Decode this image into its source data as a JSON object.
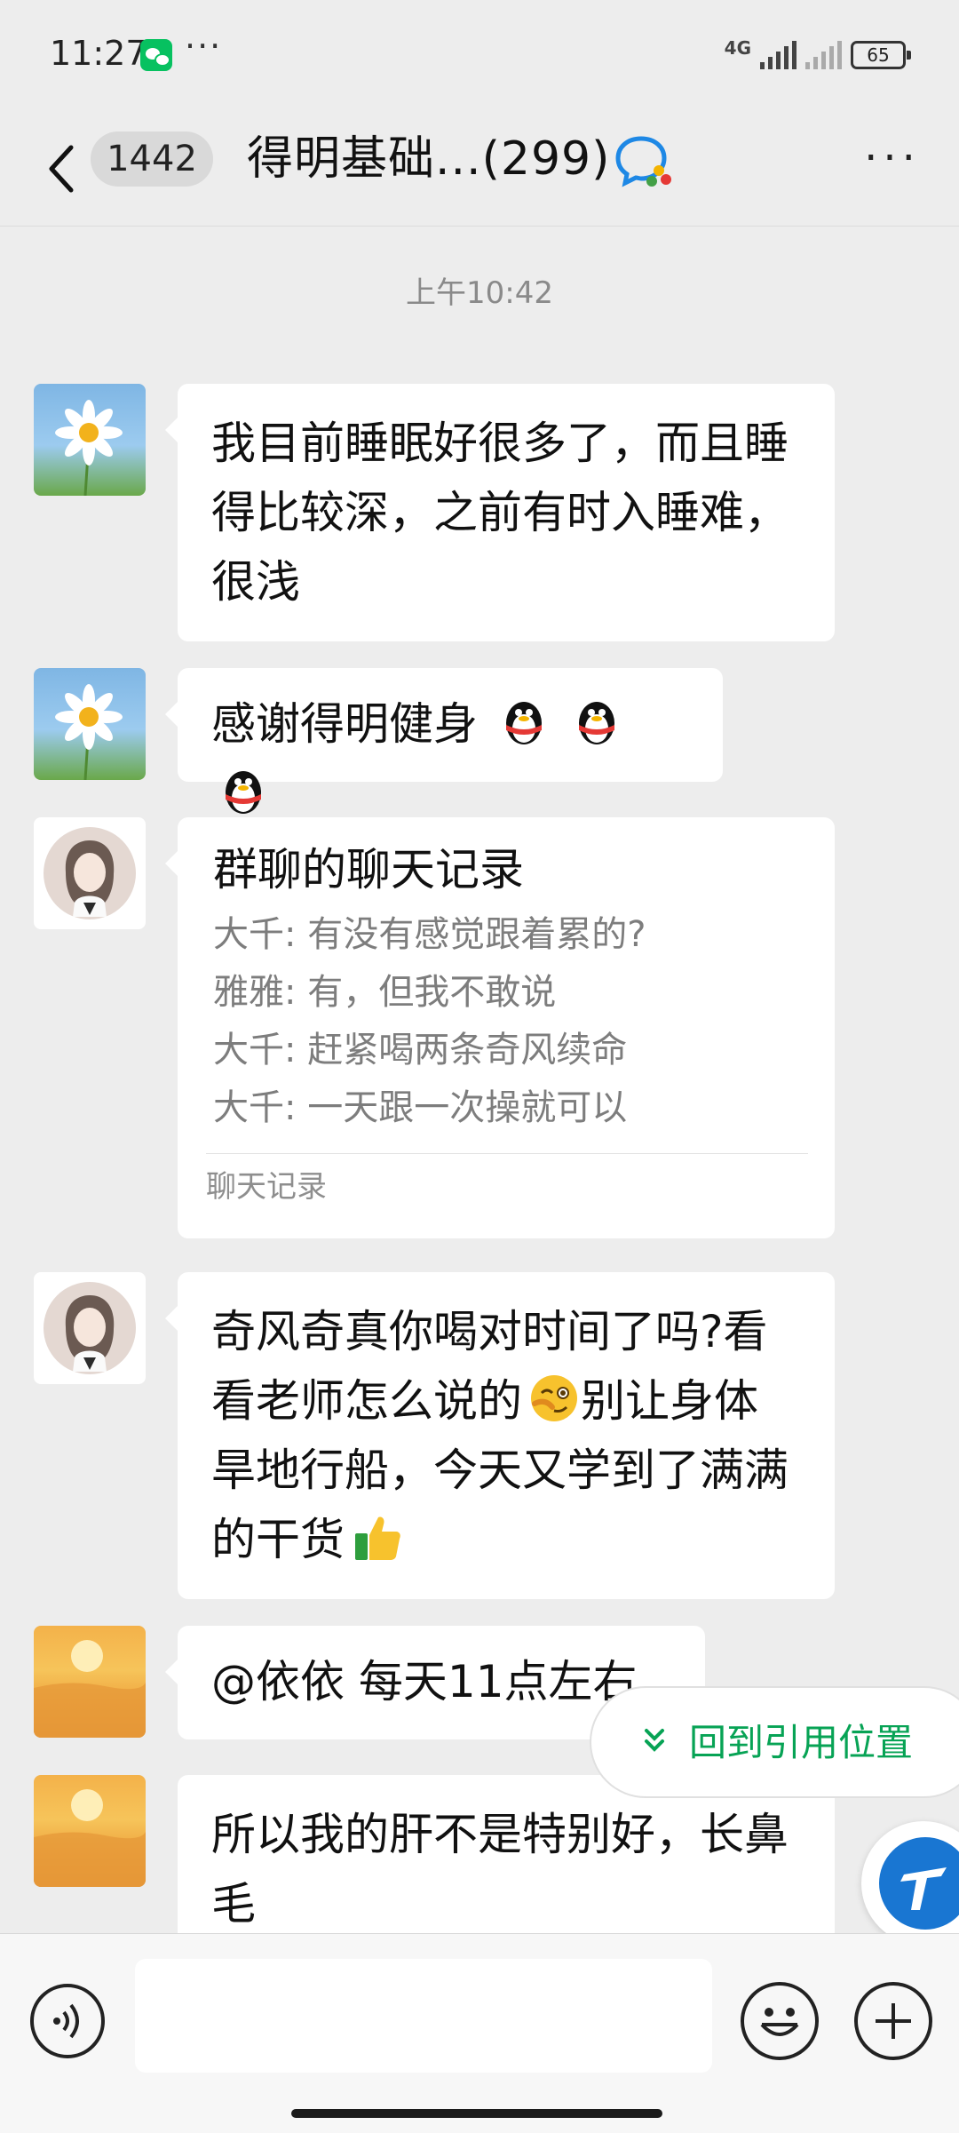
{
  "status_bar": {
    "time": "11:27",
    "network": "4G",
    "battery": "65"
  },
  "header": {
    "unread_count": "1442",
    "title": "得明基础...(299)"
  },
  "messages": {
    "timestamp": "上午10:42",
    "m1_text": "我目前睡眠好很多了，而且睡得比较深，之前有时入睡难，很浅",
    "m2_text": "感谢得明健身",
    "record": {
      "title": "群聊的聊天记录",
      "lines": [
        "大千: 有没有感觉跟着累的?",
        "雅雅: 有，但我不敢说",
        "大千: 赶紧喝两条奇风续命",
        "大千: 一天跟一次操就可以"
      ],
      "footer": "聊天记录"
    },
    "m4_part1": "奇风奇真你喝对时间了吗?看看老师怎么说的",
    "m4_part2": "别让身体旱地行船，今天又学到了满满的干货",
    "m5_text": "@依依  每天11点左右",
    "m6_text": "所以我的肝不是特别好，长鼻毛"
  },
  "jump_to_quote": "回到引用位置",
  "icons": {
    "back": "chevron-left-icon",
    "group": "group-chat-icon",
    "more": "more-icon",
    "voice": "voice-icon",
    "emoji": "emoji-icon",
    "plus": "plus-icon"
  },
  "colors": {
    "accent_green": "#07a355",
    "background": "#ededed",
    "bubble": "#ffffff"
  }
}
